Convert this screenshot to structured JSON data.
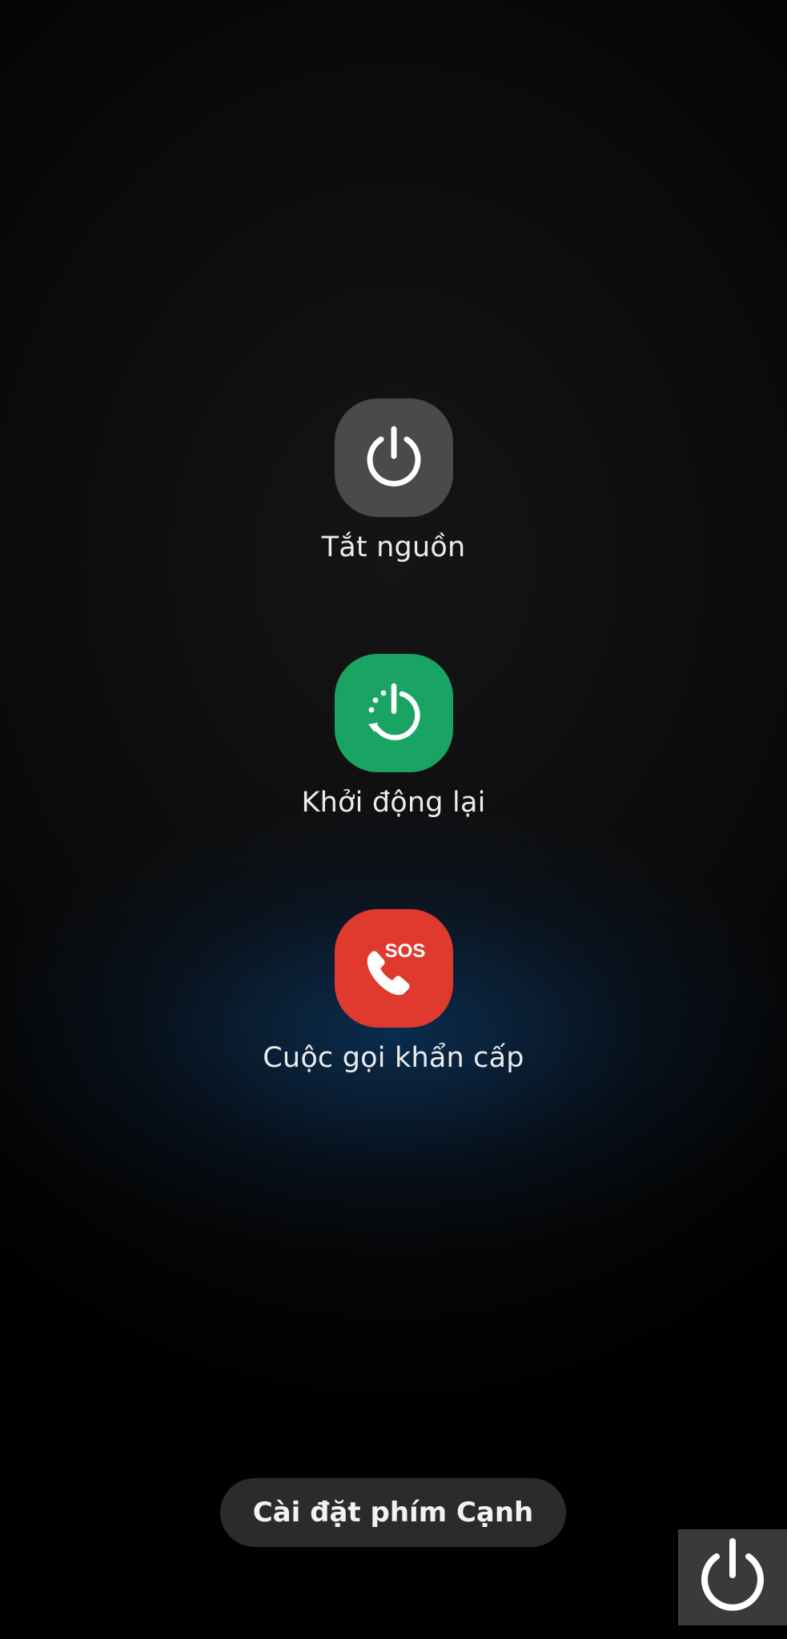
{
  "power_menu": {
    "power_off": {
      "label": "Tắt nguồn",
      "icon": "power-icon",
      "color": "#4a4a4a"
    },
    "restart": {
      "label": "Khởi động lại",
      "icon": "restart-icon",
      "color": "#1aa463"
    },
    "emergency_call": {
      "label": "Cuộc gọi khẩn cấp",
      "icon": "sos-phone-icon",
      "badge": "SOS",
      "color": "#e03a2f"
    }
  },
  "side_key_settings": {
    "label": "Cài đặt phím Cạnh"
  },
  "overlay": {
    "icon": "power-icon"
  }
}
